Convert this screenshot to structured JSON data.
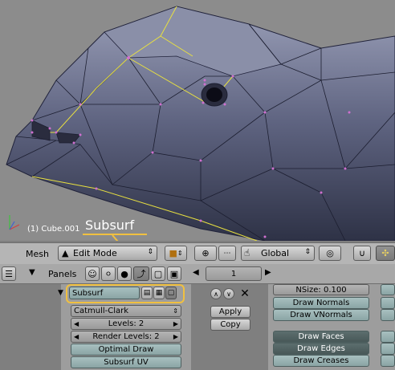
{
  "viewport": {
    "object_label": "(1) Cube.001",
    "callout": "Subsurf"
  },
  "header": {
    "mesh_menu": "Mesh",
    "mode_label": "Edit Mode",
    "orientation_label": "Global"
  },
  "panels_bar": {
    "label": "Panels",
    "page_number": "1"
  },
  "modifier": {
    "name": "Subsurf",
    "type_label": "Catmull-Clark",
    "levels_label": "Levels: 2",
    "render_levels_label": "Render Levels: 2",
    "optimal_draw_label": "Optimal Draw",
    "subsurf_uv_label": "Subsurf UV",
    "apply_label": "Apply",
    "copy_label": "Copy"
  },
  "mesh_tools": {
    "nsize_label": "NSize: 0.100",
    "draw_normals_label": "Draw Normals",
    "draw_vnormals_label": "Draw VNormals",
    "draw_faces_label": "Draw Faces",
    "draw_edges_label": "Draw Edges",
    "draw_creases_label": "Draw Creases"
  },
  "colors": {
    "callout": "#f0c040",
    "mesh": "#5a5f78",
    "selected_edge": "#e8e040",
    "vertex": "#d070d0"
  }
}
